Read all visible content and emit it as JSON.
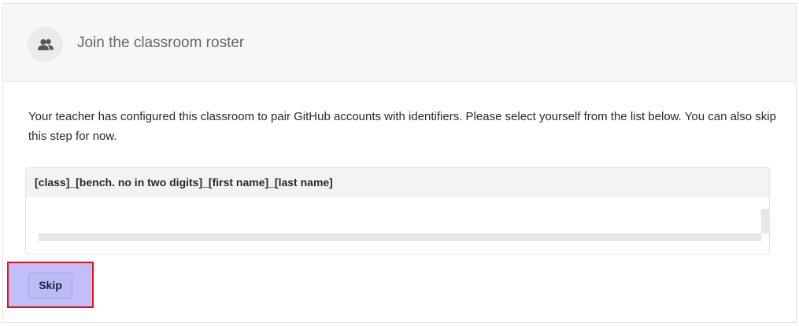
{
  "header": {
    "title": "Join the classroom roster",
    "icon": "people-icon"
  },
  "main": {
    "description": "Your teacher has configured this classroom to pair GitHub accounts with identifiers. Please select yourself from the list below. You can also skip this step for now.",
    "roster": {
      "column_header": "[class]_[bench. no in two digits]_[first name]_[last name]",
      "rows": []
    },
    "skip_label": "Skip"
  },
  "colors": {
    "highlight_fill": "#c0bff9",
    "highlight_border": "#e8101a",
    "header_background": "#f7f7f7"
  }
}
